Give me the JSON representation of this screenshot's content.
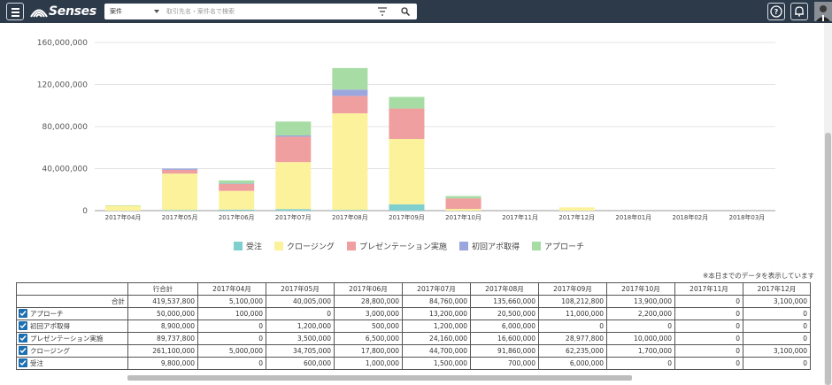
{
  "app": {
    "logo_text": "Senses"
  },
  "search": {
    "category": "案件",
    "placeholder": "取引先名・案件名で検索"
  },
  "icons": {
    "menu": "hamburger-menu-icon",
    "filter": "filter-icon",
    "search": "search-icon",
    "help": "help-circle-icon",
    "notifications": "bell-icon",
    "user": "user-avatar"
  },
  "colors": {
    "topbar": "#2c3a4a",
    "received": "#7ecfcd",
    "closing": "#fdf29c",
    "presentation": "#ef9f9f",
    "first_appointment": "#9aa6dd",
    "approach": "#a7dca4"
  },
  "chart_data": {
    "type": "bar",
    "stacked": true,
    "categories": [
      "2017年04月",
      "2017年05月",
      "2017年06月",
      "2017年07月",
      "2017年08月",
      "2017年09月",
      "2017年10月",
      "2017年11月",
      "2017年12月",
      "2018年01月",
      "2018年02月",
      "2018年03月"
    ],
    "series": [
      {
        "name": "受注",
        "color": "#7ecfcd",
        "values": [
          0,
          600000,
          1000000,
          1500000,
          700000,
          6000000,
          0,
          0,
          0,
          0,
          0,
          0
        ]
      },
      {
        "name": "クロージング",
        "color": "#fdf29c",
        "values": [
          5000000,
          34705000,
          17800000,
          44700000,
          91860000,
          62235000,
          1700000,
          0,
          3100000,
          0,
          0,
          0
        ]
      },
      {
        "name": "プレゼンテーション実施",
        "color": "#ef9f9f",
        "values": [
          0,
          3500000,
          6500000,
          24160000,
          16600000,
          28977000,
          10000000,
          0,
          0,
          0,
          0,
          0
        ]
      },
      {
        "name": "初回アポ取得",
        "color": "#9aa6dd",
        "values": [
          0,
          1200000,
          500000,
          1200000,
          6000000,
          0,
          0,
          0,
          0,
          0,
          0,
          0
        ]
      },
      {
        "name": "アプローチ",
        "color": "#a7dca4",
        "values": [
          100000,
          0,
          3000000,
          13200000,
          20500000,
          11000000,
          2200000,
          0,
          0,
          0,
          0,
          0
        ]
      }
    ],
    "yticks": [
      "0",
      "40,000,000",
      "80,000,000",
      "120,000,000",
      "160,000,000"
    ],
    "ylim": [
      0,
      160000000
    ],
    "grid": true,
    "legend": "bottom-center"
  },
  "table": {
    "note": "※本日までのデータを表示しています",
    "headers": [
      "",
      "行合計",
      "2017年04月",
      "2017年05月",
      "2017年06月",
      "2017年07月",
      "2017年08月",
      "2017年09月",
      "2017年10月",
      "2017年11月",
      "2017年12月"
    ],
    "total_row": {
      "label": "合計",
      "values": [
        "419,537,800",
        "5,100,000",
        "40,005,000",
        "28,800,000",
        "84,760,000",
        "135,660,000",
        "108,212,800",
        "13,900,000",
        "0",
        "3,100,000"
      ]
    },
    "rows": [
      {
        "label": "アプローチ",
        "checked": true,
        "values": [
          "50,000,000",
          "100,000",
          "0",
          "3,000,000",
          "13,200,000",
          "20,500,000",
          "11,000,000",
          "2,200,000",
          "0",
          "0"
        ]
      },
      {
        "label": "初回アポ取得",
        "checked": true,
        "values": [
          "8,900,000",
          "0",
          "1,200,000",
          "500,000",
          "1,200,000",
          "6,000,000",
          "0",
          "0",
          "0",
          "0"
        ]
      },
      {
        "label": "プレゼンテーション実施",
        "checked": true,
        "values": [
          "89,737,800",
          "0",
          "3,500,000",
          "6,500,000",
          "24,160,000",
          "16,600,000",
          "28,977,800",
          "10,000,000",
          "0",
          "0"
        ]
      },
      {
        "label": "クロージング",
        "checked": true,
        "values": [
          "261,100,000",
          "5,000,000",
          "34,705,000",
          "17,800,000",
          "44,700,000",
          "91,860,000",
          "62,235,000",
          "1,700,000",
          "0",
          "3,100,000"
        ]
      },
      {
        "label": "受注",
        "checked": true,
        "values": [
          "9,800,000",
          "0",
          "600,000",
          "1,000,000",
          "1,500,000",
          "700,000",
          "6,000,000",
          "0",
          "0",
          "0"
        ]
      }
    ]
  }
}
